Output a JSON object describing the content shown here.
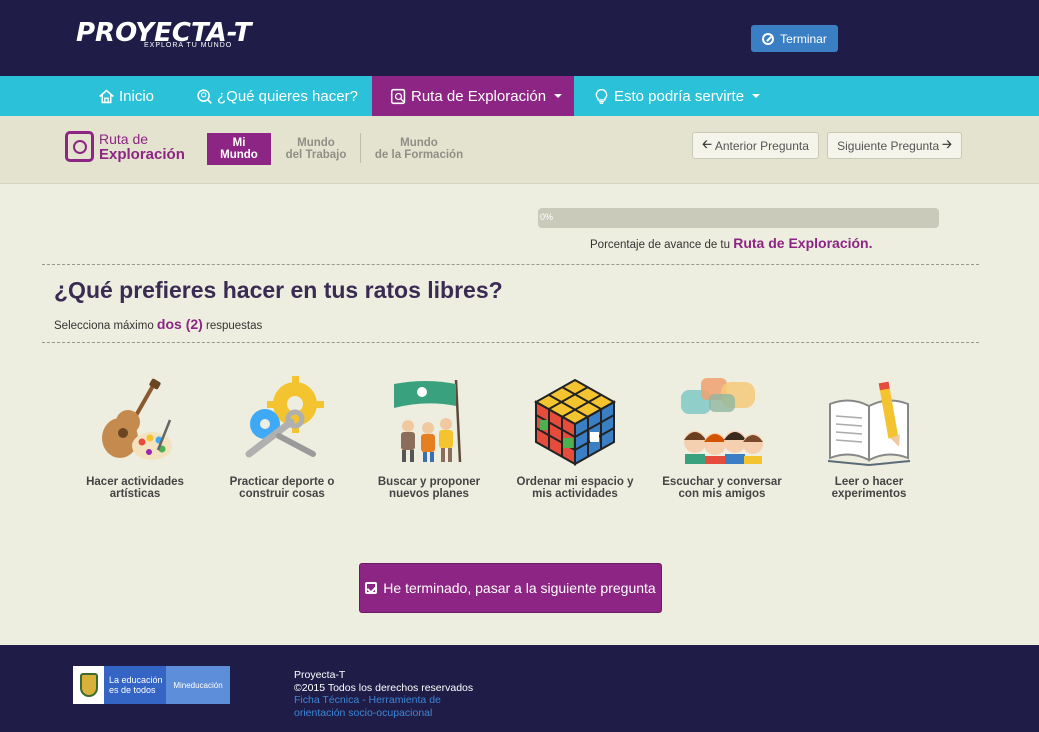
{
  "header": {
    "logo_text": "PROYECTA-T",
    "logo_tagline": "EXPLORA TU MUNDO",
    "finish_button": "Terminar"
  },
  "nav": {
    "items": [
      {
        "label": "Inicio"
      },
      {
        "label": "¿Qué quieres hacer?"
      },
      {
        "label": "Ruta de Exploración"
      },
      {
        "label": "Esto podría servirte"
      }
    ]
  },
  "route": {
    "logo_line1": "Ruta de",
    "logo_line2": "Exploración",
    "tabs": [
      {
        "line1": "Mi",
        "line2": "Mundo"
      },
      {
        "line1": "Mundo",
        "line2": "del Trabajo"
      },
      {
        "line1": "Mundo",
        "line2": "de la Formación"
      }
    ],
    "prev_button": "Anterior Pregunta",
    "next_button": "Siguiente Pregunta"
  },
  "progress": {
    "value_pct": 0,
    "label": "0%",
    "caption": "Porcentaje de avance de tu",
    "caption_bold": "Ruta de Exploración."
  },
  "question": {
    "title": "¿Qué prefieres hacer en tus ratos libres?",
    "instruction_pre": "Selecciona máximo",
    "instruction_bold": "dos (2)",
    "instruction_post": "respuestas"
  },
  "options": [
    {
      "line1": "Hacer actividades",
      "line2": "artísticas",
      "icon": "guitar-palette-icon"
    },
    {
      "line1": "Practicar deporte o",
      "line2": "construir cosas",
      "icon": "gears-wrench-icon"
    },
    {
      "line1": "Buscar y proponer",
      "line2": "nuevos planes",
      "icon": "explorers-flag-icon"
    },
    {
      "line1": "Ordenar mi espacio y",
      "line2": "mis actividades",
      "icon": "rubiks-cube-icon"
    },
    {
      "line1": "Escuchar y conversar",
      "line2": "con mis amigos",
      "icon": "friends-chat-icon"
    },
    {
      "line1": "Leer o hacer",
      "line2": "experimentos",
      "icon": "book-pencil-icon"
    }
  ],
  "submit_button": "He terminado, pasar a la siguiente pregunta",
  "footer": {
    "logo_a": "La educación es de todos",
    "logo_b": "Mineducación",
    "line1": "Proyecta-T",
    "line2": "©2015 Todos los derechos reservados",
    "link1": "Ficha Técnica - Herramienta de",
    "link2": "orientación socio-ocupacional"
  },
  "colors": {
    "header_bg": "#1f1d48",
    "nav_bg": "#2bc1d8",
    "accent": "#8c2583",
    "page_bg": "#eeeee0"
  }
}
